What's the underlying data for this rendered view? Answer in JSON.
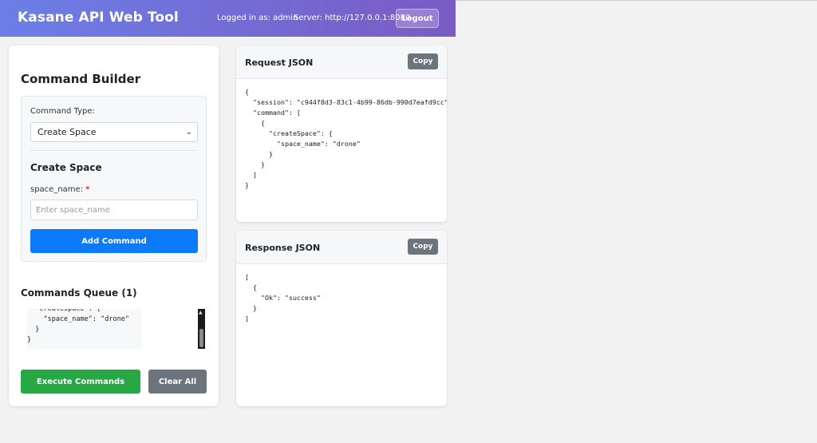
{
  "header": {
    "title": "Kasane API Web Tool",
    "logged_in": "Logged in as: admin",
    "server": "Server: http://127.0.0.1:8080",
    "logout_label": "Logout"
  },
  "builder": {
    "title": "Command Builder",
    "command_type_label": "Command Type:",
    "command_type_value": "Create Space",
    "section_title": "Create Space",
    "field_label": "space_name:",
    "required_mark": "*",
    "field_placeholder": "Enter space_name",
    "add_button": "Add Command"
  },
  "queue": {
    "title": "Commands Queue (1)",
    "visible_text": "  \"createSpace\": {\n    \"space_name\": \"drone\"\n  }\n}"
  },
  "actions": {
    "execute_label": "Execute Commands",
    "clear_label": "Clear All"
  },
  "request": {
    "title": "Request JSON",
    "copy_label": "Copy",
    "body": "{\n  \"session\": \"c944f8d3-83c1-4b99-86db-990d7eafd9cc\",\n  \"command\": [\n    {\n      \"createSpace\": {\n        \"space_name\": \"drone\"\n      }\n    }\n  ]\n}"
  },
  "response": {
    "title": "Response JSON",
    "copy_label": "Copy",
    "body": "[\n  {\n    \"Ok\": \"success\"\n  }\n]"
  },
  "colors": {
    "header_gradient_start": "#6b7fe6",
    "header_gradient_end": "#7a5bc4",
    "primary": "#0b7bfb",
    "success": "#27a845",
    "secondary": "#6c757d"
  },
  "icons": {
    "select_arrow": "chevron-down-icon",
    "scroll_up": "scroll-up-arrow-icon"
  }
}
